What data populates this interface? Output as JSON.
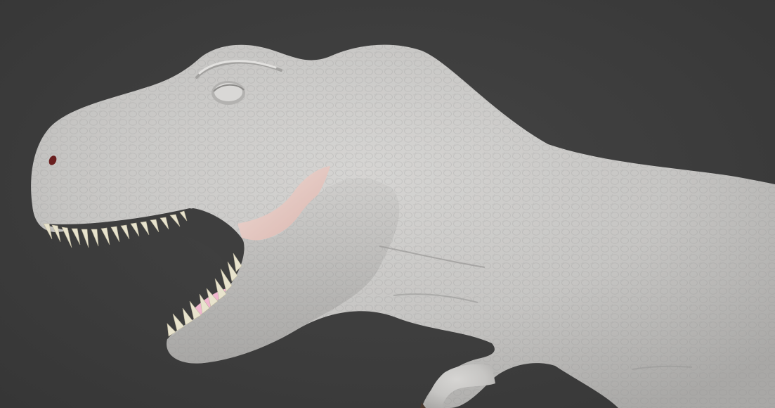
{
  "viewport": {
    "background_color": "#3d3d3d",
    "model_color": "#c9c8c6",
    "model_shadow_color": "#9f9d9b",
    "mouth_interior_color": "#e6c8c2",
    "tongue_color": "#f2b8d2",
    "teeth_color": "#e9e4cf",
    "subject_icon": "tyrannosaurus-head-sculpt"
  }
}
